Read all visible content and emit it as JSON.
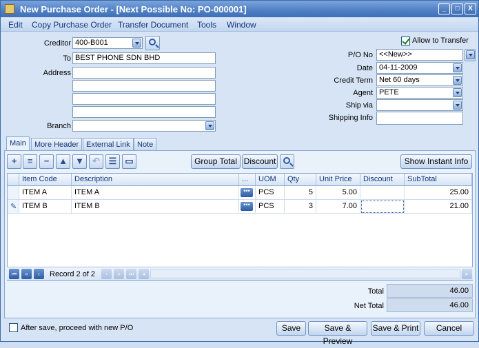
{
  "window": {
    "title": "New Purchase Order - [Next Possible No: PO-000001]",
    "controls": [
      "_",
      "□",
      "X"
    ]
  },
  "menu": [
    "Edit",
    "Copy Purchase Order",
    "Transfer Document",
    "Tools",
    "Window"
  ],
  "header": {
    "creditor_label": "Creditor",
    "creditor_value": "400-B001",
    "to_label": "To",
    "to_value": "BEST PHONE SDN BHD",
    "address_label": "Address",
    "branch_label": "Branch",
    "branch_value": "",
    "allow_transfer_label": "Allow to Transfer",
    "allow_transfer_checked": true,
    "po_no_label": "P/O  No",
    "po_no_value": "<<New>>",
    "date_label": "Date",
    "date_value": "04-11-2009",
    "credit_term_label": "Credit Term",
    "credit_term_value": "Net 60 days",
    "agent_label": "Agent",
    "agent_value": "PETE",
    "ship_via_label": "Ship via",
    "ship_via_value": "",
    "shipping_info_label": "Shipping Info",
    "shipping_info_value": ""
  },
  "tabs": [
    "Main",
    "More Header",
    "External Link",
    "Note"
  ],
  "toolbar": {
    "group_total": "Group Total",
    "discount": "Discount",
    "show_instant_info": "Show Instant Info"
  },
  "grid": {
    "columns": [
      "Item Code",
      "Description",
      "...",
      "UOM",
      "Qty",
      "Unit Price",
      "Discount",
      "SubTotal"
    ],
    "rows": [
      {
        "item_code": "ITEM A",
        "description": "ITEM A",
        "uom": "PCS",
        "qty": "5",
        "unit_price": "5.00",
        "discount": "",
        "subtotal": "25.00"
      },
      {
        "item_code": "ITEM B",
        "description": "ITEM B",
        "uom": "PCS",
        "qty": "3",
        "unit_price": "7.00",
        "discount": "",
        "subtotal": "21.00"
      }
    ],
    "record_text": "Record 2 of 2"
  },
  "totals": {
    "total_label": "Total",
    "total_value": "46.00",
    "net_total_label": "Net Total",
    "net_total_value": "46.00"
  },
  "footer": {
    "after_save_label": "After save, proceed with new P/O",
    "after_save_checked": false,
    "save": "Save",
    "save_preview": "Save & Preview",
    "save_print": "Save & Print",
    "cancel": "Cancel"
  }
}
